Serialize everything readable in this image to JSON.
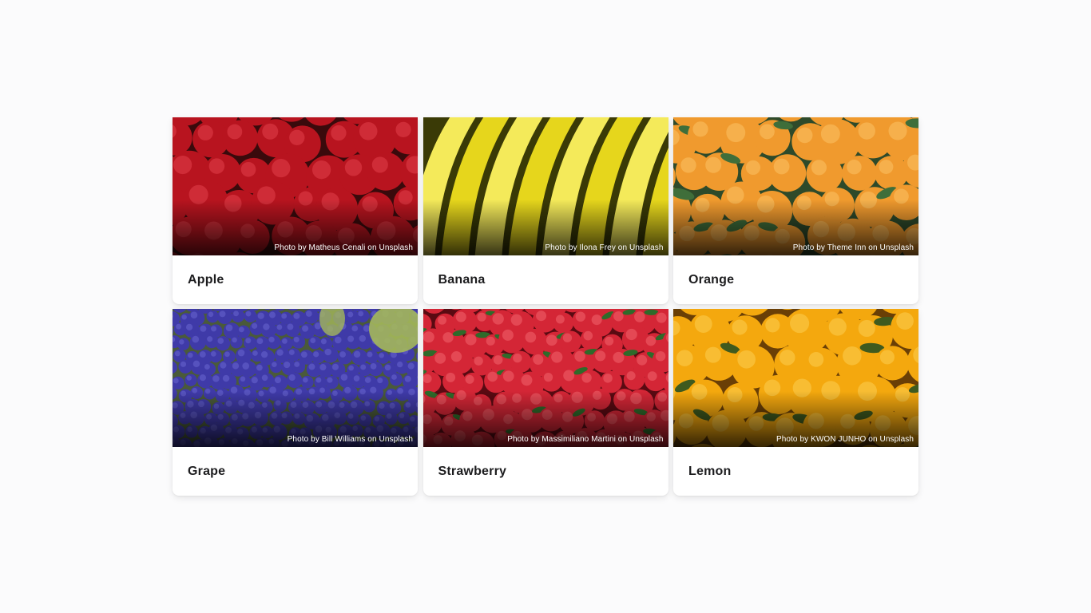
{
  "cards": [
    {
      "name": "Apple",
      "credit": "Photo by Matheus Cenali on Unsplash",
      "fruit": "apple",
      "colors": {
        "bg": "#3a0a0c",
        "fruit": "#b8141f",
        "highlight": "#e2404a",
        "accent": "#6b0f14"
      }
    },
    {
      "name": "Banana",
      "credit": "Photo by Ilona Frey on Unsplash",
      "fruit": "banana",
      "colors": {
        "bg": "#3a3a06",
        "fruit": "#e6d61c",
        "highlight": "#f4ea5a",
        "accent": "#8a8a12"
      }
    },
    {
      "name": "Orange",
      "credit": "Photo by Theme Inn on Unsplash",
      "fruit": "orange",
      "colors": {
        "bg": "#2e4a2a",
        "fruit": "#f09a2e",
        "highlight": "#fbc266",
        "accent": "#3f6e3a"
      }
    },
    {
      "name": "Grape",
      "credit": "Photo by Bill Williams on Unsplash",
      "fruit": "grape",
      "colors": {
        "bg": "#4a5a3a",
        "fruit": "#3f3aa8",
        "highlight": "#6a66d0",
        "accent": "#a4b85a"
      }
    },
    {
      "name": "Strawberry",
      "credit": "Photo by Massimiliano Martini on Unsplash",
      "fruit": "strawberry",
      "colors": {
        "bg": "#5a0a12",
        "fruit": "#d42636",
        "highlight": "#f0646e",
        "accent": "#2f6a2a"
      }
    },
    {
      "name": "Lemon",
      "credit": "Photo by KWON JUNHO on Unsplash",
      "fruit": "lemon",
      "colors": {
        "bg": "#6a3f06",
        "fruit": "#f4a80e",
        "highlight": "#fbcd52",
        "accent": "#3f5a1e"
      }
    }
  ]
}
